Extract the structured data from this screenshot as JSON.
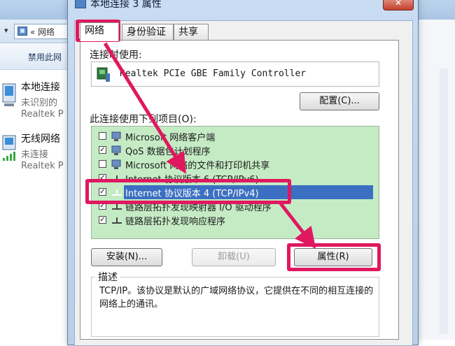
{
  "background": {
    "address_crumb": "« 网络",
    "command_left": "禁用此网",
    "connections": [
      {
        "name": "本地连接",
        "status": "未识别的",
        "device": "Realtek P"
      },
      {
        "name": "无线网络",
        "status": "未连接",
        "device": "Realtek P"
      }
    ]
  },
  "dialog": {
    "title": "本地连接 3 属性",
    "close_glyph": "✕",
    "tabs": [
      {
        "label": "网络"
      },
      {
        "label": "身份验证"
      },
      {
        "label": "共享"
      }
    ],
    "connect_using_label": "连接时使用:",
    "adapter_name": "Realtek PCIe GBE Family Controller",
    "configure_button": "配置(C)...",
    "items_label": "此连接使用下列项目(O):",
    "items": [
      {
        "checked": false,
        "icon": "network-client-icon",
        "label": "Microsoft 网络客户端"
      },
      {
        "checked": true,
        "icon": "qos-scheduler-icon",
        "label": "QoS 数据包计划程序"
      },
      {
        "checked": false,
        "icon": "file-printer-sharing-icon",
        "label": "Microsoft 网络的文件和打印机共享"
      },
      {
        "checked": true,
        "icon": "protocol-icon",
        "label": "Internet 协议版本 6 (TCP/IPv6)"
      },
      {
        "checked": true,
        "icon": "protocol-icon",
        "label": "Internet 协议版本 4 (TCP/IPv4)",
        "selected": true
      },
      {
        "checked": true,
        "icon": "protocol-icon",
        "label": "链路层拓扑发现映射器 I/O 驱动程序"
      },
      {
        "checked": true,
        "icon": "protocol-icon",
        "label": "链路层拓扑发现响应程序"
      }
    ],
    "install_button": "安装(N)...",
    "uninstall_button": "卸载(U)",
    "properties_button": "属性(R)",
    "description_label": "描述",
    "description_text": "TCP/IP。该协议是默认的广域网络协议，它提供在不同的相互连接的网络上的通讯。"
  },
  "colors": {
    "annotation": "#e0185f",
    "selection": "#3b6fc1",
    "list_background": "#c5ebc5"
  }
}
